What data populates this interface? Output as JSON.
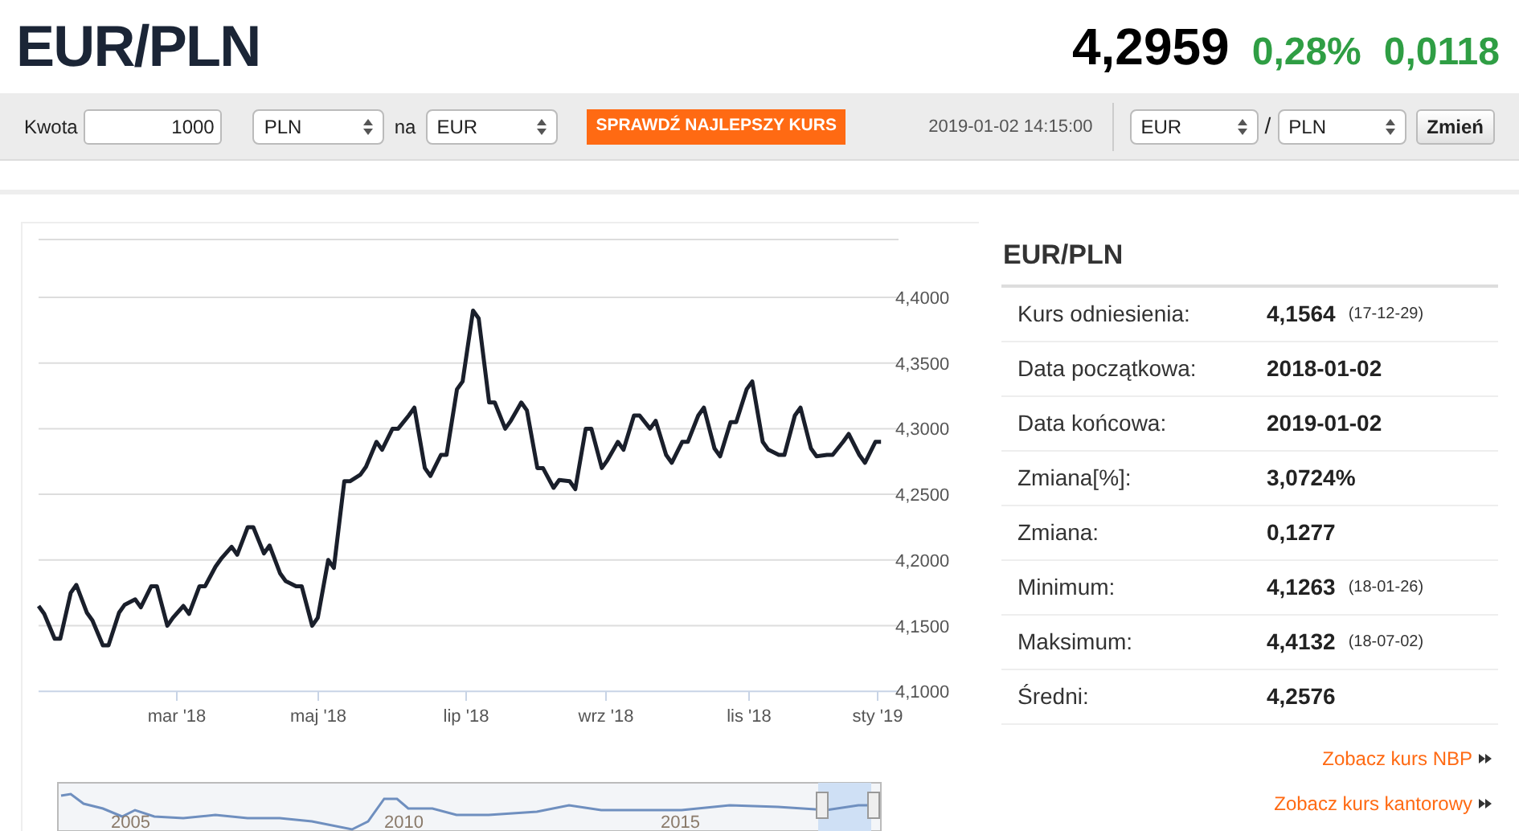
{
  "header": {
    "pair": "EUR/PLN",
    "rate": "4,2959",
    "change_pct": "0,28%",
    "change_abs": "0,0118"
  },
  "toolbar": {
    "amount_label": "Kwota",
    "amount": "1000",
    "from": "PLN",
    "to_label": "na",
    "to": "EUR",
    "cta": "SPRAWDŹ NAJLEPSZY KURS",
    "timestamp": "2019-01-02 14:15:00",
    "base": "EUR",
    "separator": "/",
    "quote": "PLN",
    "apply": "Zmień"
  },
  "chart": {
    "y_labels": [
      "4,4000",
      "4,3500",
      "4,3000",
      "4,2500",
      "4,2000",
      "4,1500",
      "4,1000"
    ],
    "x_labels": [
      "mar '18",
      "maj '18",
      "lip '18",
      "wrz '18",
      "lis '18",
      "sty '19"
    ]
  },
  "navigator": {
    "labels": [
      "2005",
      "2010",
      "2015"
    ]
  },
  "stats": {
    "title": "EUR/PLN",
    "rows": [
      {
        "label": "Kurs odniesienia:",
        "value": "4,1564",
        "date": "(17-12-29)"
      },
      {
        "label": "Data początkowa:",
        "value": "2018-01-02"
      },
      {
        "label": "Data końcowa:",
        "value": "2019-01-02"
      },
      {
        "label": "Zmiana[%]:",
        "value": "3,0724%"
      },
      {
        "label": "Zmiana:",
        "value": "0,1277"
      },
      {
        "label": "Minimum:",
        "value": "4,1263",
        "date": "(18-01-26)"
      },
      {
        "label": "Maksimum:",
        "value": "4,4132",
        "date": "(18-07-02)"
      },
      {
        "label": "Średni:",
        "value": "4,2576"
      }
    ],
    "links": [
      {
        "text": "Zobacz kurs NBP"
      },
      {
        "text": "Zobacz kurs kantorowy"
      }
    ]
  }
}
